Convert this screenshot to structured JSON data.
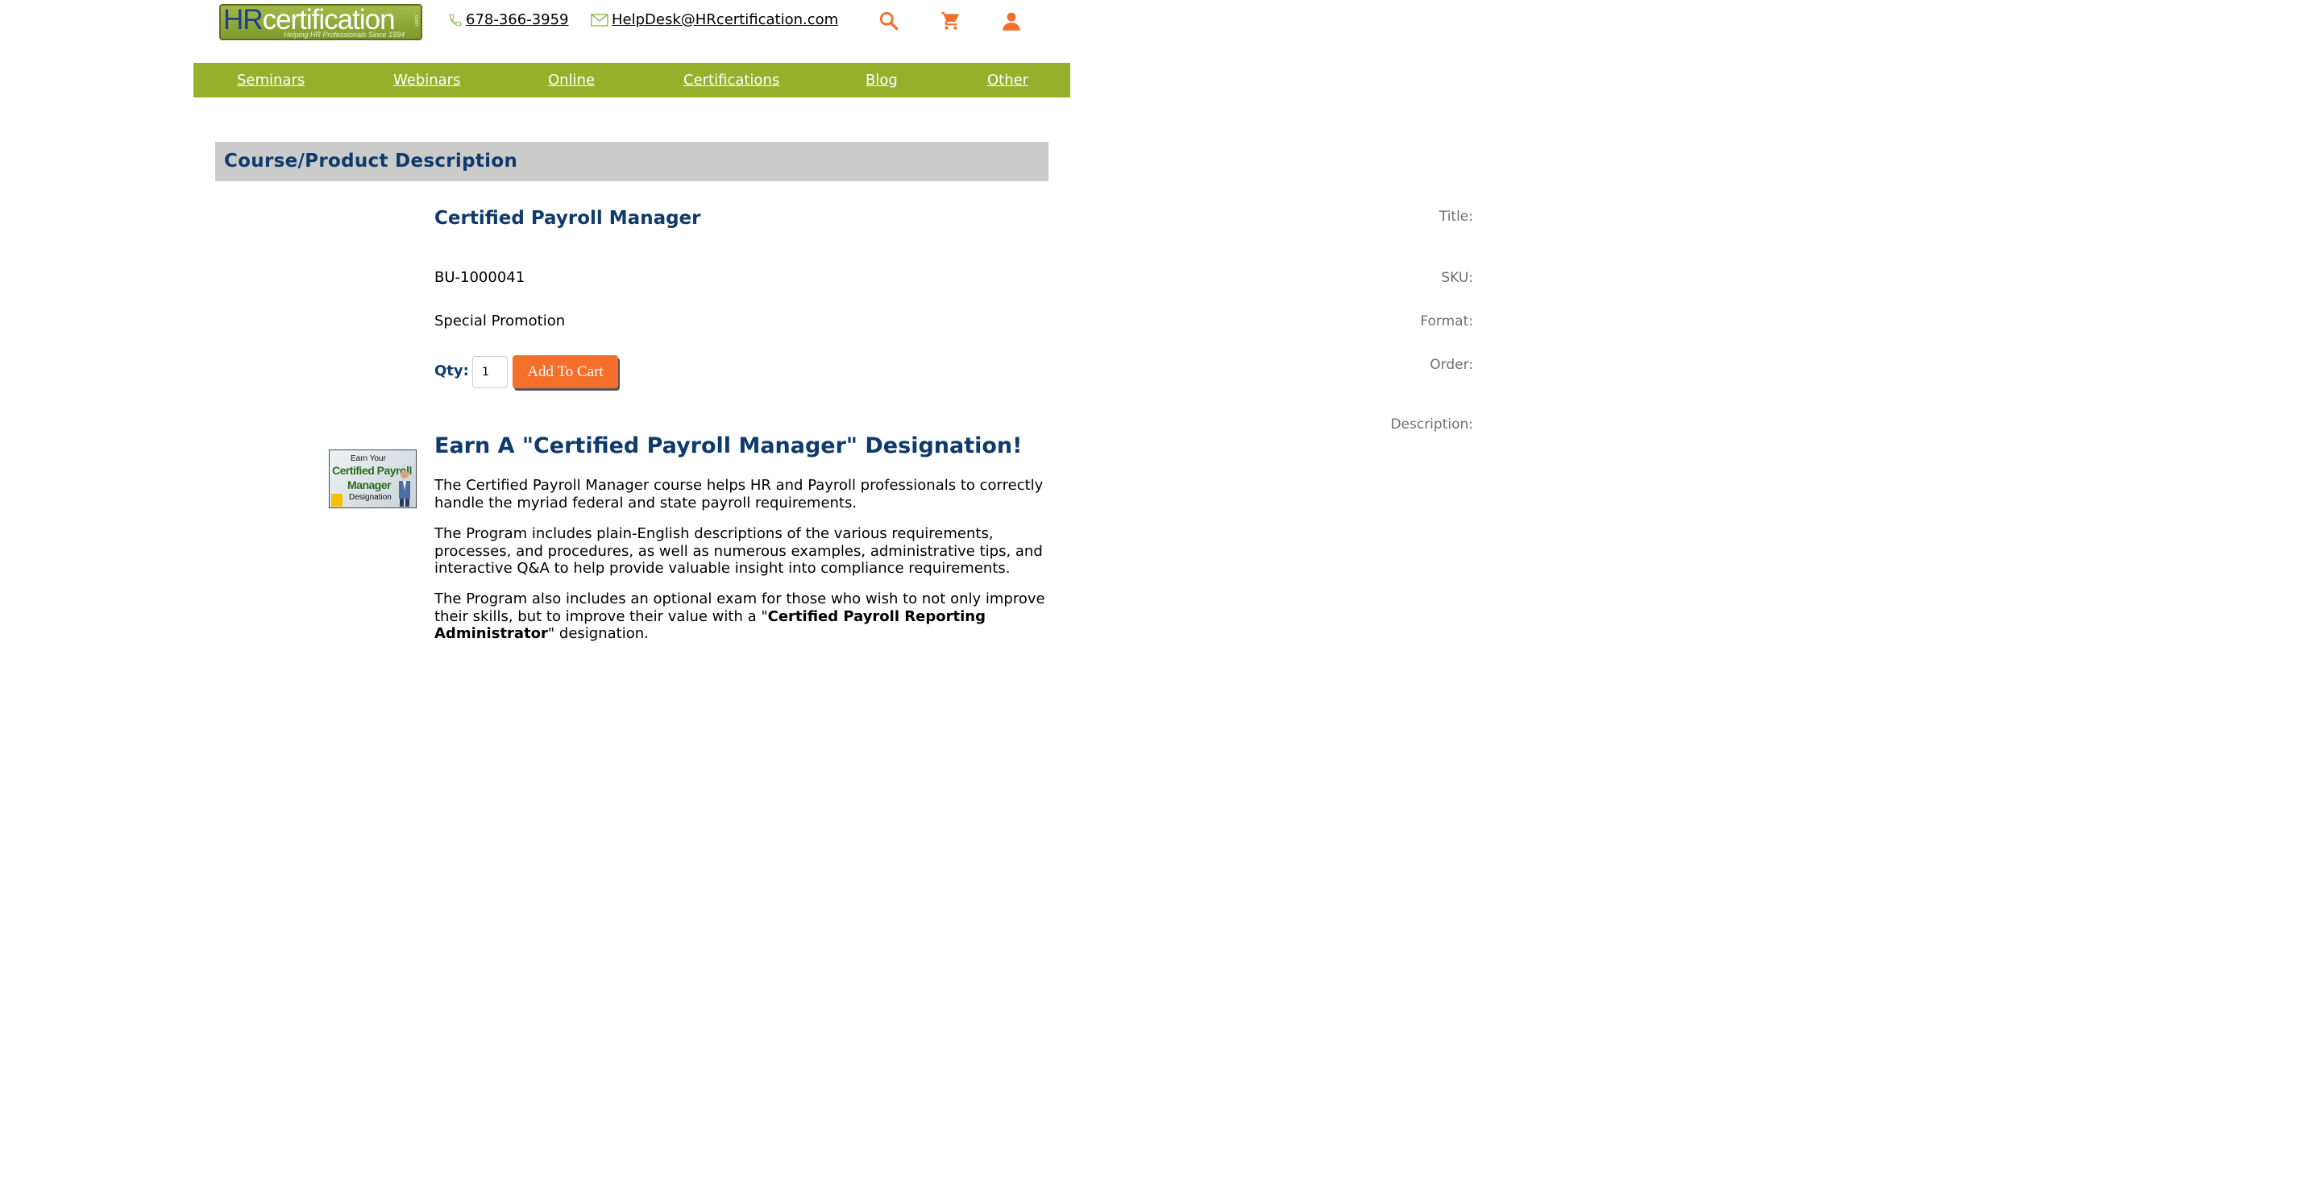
{
  "header": {
    "logo": {
      "main_left": "HR",
      "main_right": "certification",
      "tagline": "Helping HR Professionals Since 1994",
      "suffix": ".com"
    },
    "phone": " 678-366-3959",
    "email": " HelpDesk@HRcertification.com",
    "icons": [
      "search-icon",
      "cart-icon",
      "account-icon"
    ],
    "icon_color": "#f36f2b"
  },
  "nav": {
    "color": "#97b02c",
    "items": [
      "Seminars",
      "Webinars",
      "Online",
      "Certifications",
      "Blog",
      "Other"
    ]
  },
  "section": {
    "title": "Course/Product Description"
  },
  "product": {
    "labels": {
      "title": "Title:",
      "sku": "SKU:",
      "format": "Format:",
      "order": "Order:",
      "description": "Description:"
    },
    "title": "Certified Payroll Manager",
    "sku": "BU-1000041",
    "format": "Special Promotion",
    "qty_label": "Qty:",
    "qty_value": "1",
    "add_to_cart": "Add To Cart",
    "image": {
      "line1": "Earn Your",
      "line2": "Certified Payroll",
      "line3": "Manager",
      "line4": "Designation"
    }
  },
  "description": {
    "heading": "Earn A \"Certified Payroll Manager\" Designation!",
    "para1": "The Certified Payroll Manager course helps HR and Payroll professionals to correctly handle the myriad federal and state payroll requirements.",
    "para2": "The Program includes plain-English descriptions of the various requirements, processes, and procedures, as well as numerous examples, administrative tips, and interactive Q&A to help provide valuable insight into compliance requirements.",
    "para3_pre": "The Program also includes an optional exam for those who wish to not only improve their skills, but to improve their value with a \"",
    "para3_bold": "Certified Payroll Reporting Administrator",
    "para3_post": "\" designation."
  }
}
